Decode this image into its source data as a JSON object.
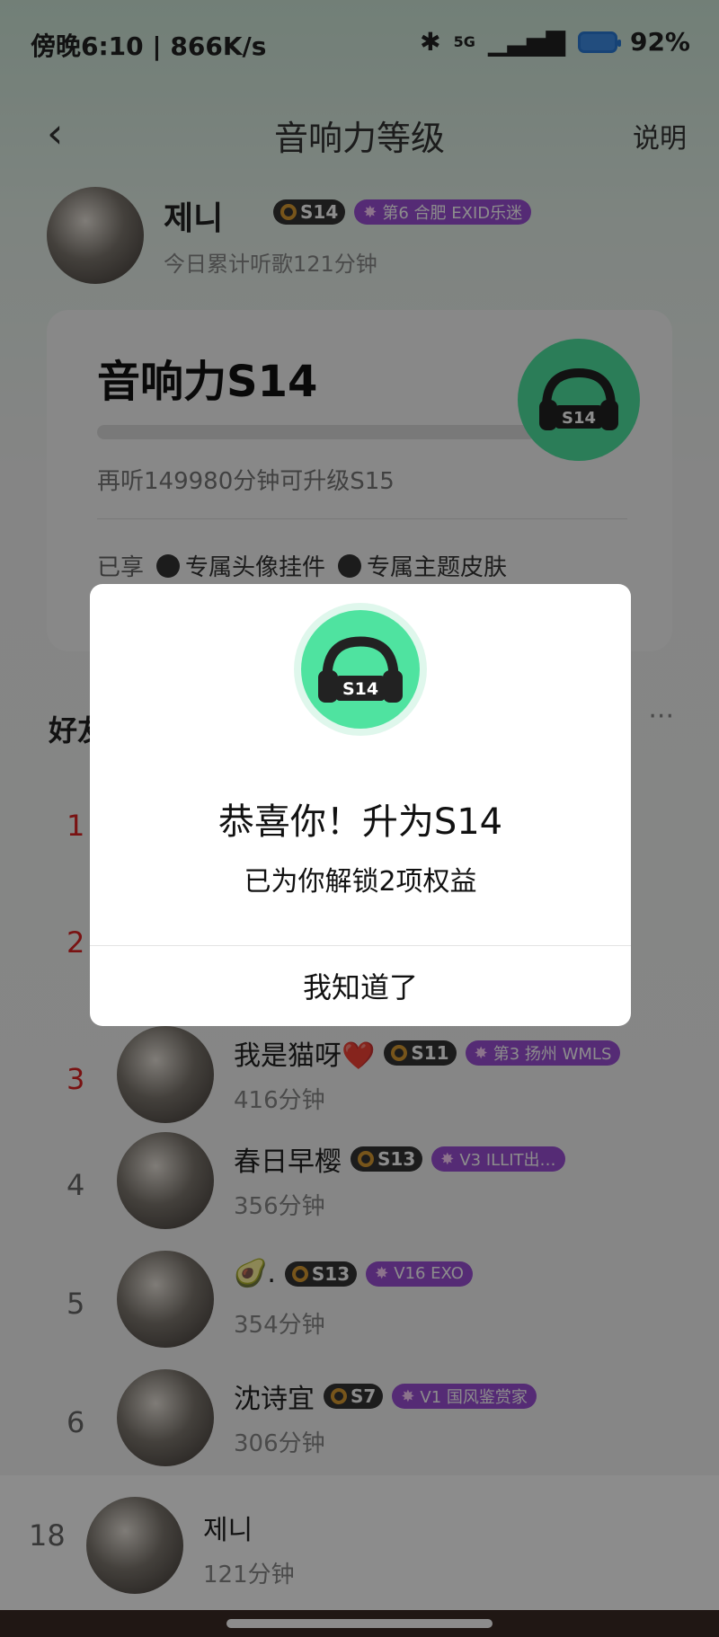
{
  "status_bar": {
    "time_speed": "傍晚6:10 | 866K/s",
    "signal": "5G",
    "battery": "92%"
  },
  "nav": {
    "title": "音响力等级",
    "help": "说明"
  },
  "user": {
    "name": "제니",
    "level_badge": "S14",
    "rank_badge": "第6 合肥 EXID乐迷",
    "listen_today": "今日累计听歌121分钟"
  },
  "card": {
    "level_title": "音响力S14",
    "progress_fraction": 0.0,
    "upgrade_hint": "再听149980分钟可升级S15",
    "perks_label": "已享",
    "perks": [
      "专属头像挂件",
      "专属主题皮肤"
    ],
    "logo_label": "S14"
  },
  "ranking": {
    "title": "好友",
    "more": "···",
    "rows": [
      {
        "rank": "1",
        "name": "",
        "level": "",
        "tag": "",
        "minutes": ""
      },
      {
        "rank": "2",
        "name": "",
        "level": "",
        "tag": "",
        "minutes": ""
      },
      {
        "rank": "3",
        "name": "我是猫呀❤️",
        "level": "S11",
        "tag": "第3 扬州 WMLS",
        "minutes": "416分钟"
      },
      {
        "rank": "4",
        "name": "春日早樱",
        "level": "S13",
        "tag": "V3 ILLIT出…",
        "minutes": "356分钟"
      },
      {
        "rank": "5",
        "name": "🥑.",
        "level": "S13",
        "tag": "V16 EXO",
        "minutes": "354分钟"
      },
      {
        "rank": "6",
        "name": "沈诗宜",
        "level": "S7",
        "tag": "V1 国风鉴赏家",
        "minutes": "306分钟"
      }
    ],
    "me": {
      "rank": "18",
      "name": "제니",
      "minutes": "121分钟"
    }
  },
  "dialog": {
    "logo_label": "S14",
    "title": "恭喜你！升为S14",
    "subtitle": "已为你解锁2项权益",
    "button": "我知道了"
  },
  "colors": {
    "accent_green": "#4fe3a0",
    "level_badge_bg": "#333333",
    "tag_purple": "#9b4fd6",
    "rank_red": "#d22222"
  }
}
